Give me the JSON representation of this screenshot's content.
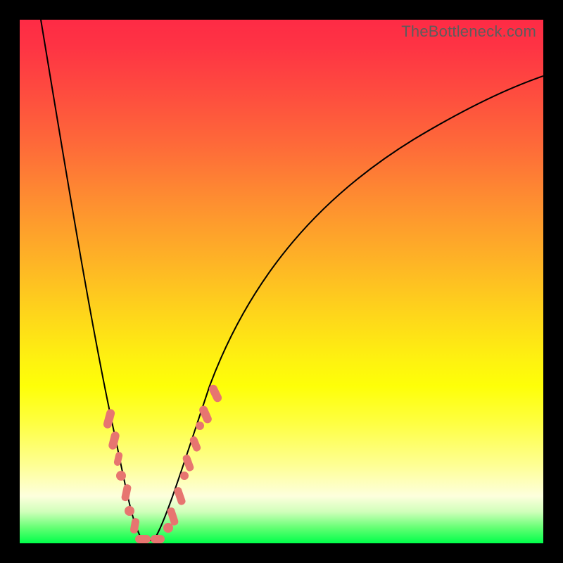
{
  "watermark": "TheBottleneck.com",
  "colors": {
    "background": "#000000",
    "marker": "#e77570",
    "curve": "#000000",
    "gradient_top": "#fe2b45",
    "gradient_bottom": "#00ff4a"
  },
  "chart_data": {
    "type": "line",
    "title": "",
    "xlabel": "",
    "ylabel": "",
    "xlim": [
      0,
      100
    ],
    "ylim": [
      0,
      100
    ],
    "grid": false,
    "legend": false,
    "series": [
      {
        "name": "bottleneck-curve",
        "x": [
          0,
          3,
          6,
          9,
          12,
          15,
          18,
          19,
          20,
          21,
          22,
          23,
          24,
          25,
          26,
          28,
          32,
          38,
          45,
          55,
          65,
          75,
          85,
          95,
          100
        ],
        "y": [
          100,
          83,
          67,
          51,
          35,
          20,
          6,
          3,
          1,
          0,
          0,
          0,
          0,
          1,
          3,
          9,
          20,
          34,
          46,
          58,
          66,
          72,
          77,
          81,
          83
        ]
      }
    ],
    "markers": [
      {
        "x": 14,
        "y": 25,
        "shape": "round-rect"
      },
      {
        "x": 15,
        "y": 20,
        "shape": "round-rect"
      },
      {
        "x": 16,
        "y": 15,
        "shape": "round-rect"
      },
      {
        "x": 17,
        "y": 10,
        "shape": "circle"
      },
      {
        "x": 18,
        "y": 7,
        "shape": "round-rect"
      },
      {
        "x": 19,
        "y": 3,
        "shape": "circle"
      },
      {
        "x": 20,
        "y": 1,
        "shape": "round-rect"
      },
      {
        "x": 21,
        "y": 0,
        "shape": "round-rect-h"
      },
      {
        "x": 23,
        "y": 0,
        "shape": "round-rect-h"
      },
      {
        "x": 25,
        "y": 1,
        "shape": "round-rect"
      },
      {
        "x": 26,
        "y": 4,
        "shape": "round-rect"
      },
      {
        "x": 27,
        "y": 8,
        "shape": "round-rect"
      },
      {
        "x": 28,
        "y": 11,
        "shape": "circle"
      },
      {
        "x": 29,
        "y": 14,
        "shape": "round-rect"
      },
      {
        "x": 30,
        "y": 17,
        "shape": "round-rect"
      },
      {
        "x": 32,
        "y": 22,
        "shape": "round-rect"
      },
      {
        "x": 34,
        "y": 27,
        "shape": "round-rect"
      }
    ]
  }
}
